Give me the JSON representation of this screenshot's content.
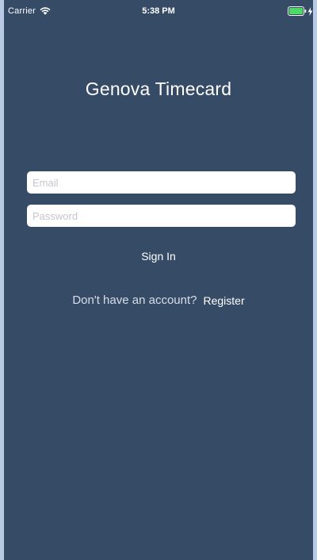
{
  "status_bar": {
    "carrier": "Carrier",
    "time": "5:38 PM",
    "icons": [
      "wifi-icon",
      "battery-icon",
      "charging-bolt-icon"
    ],
    "battery_color": "#4cd964"
  },
  "app": {
    "title": "Genova Timecard",
    "background_color": "#364b66"
  },
  "login_form": {
    "email_placeholder": "Email",
    "email_value": "",
    "password_placeholder": "Password",
    "password_value": "",
    "sign_in_label": "Sign In"
  },
  "register": {
    "prompt": "Don't have an account?",
    "link_label": "Register"
  }
}
